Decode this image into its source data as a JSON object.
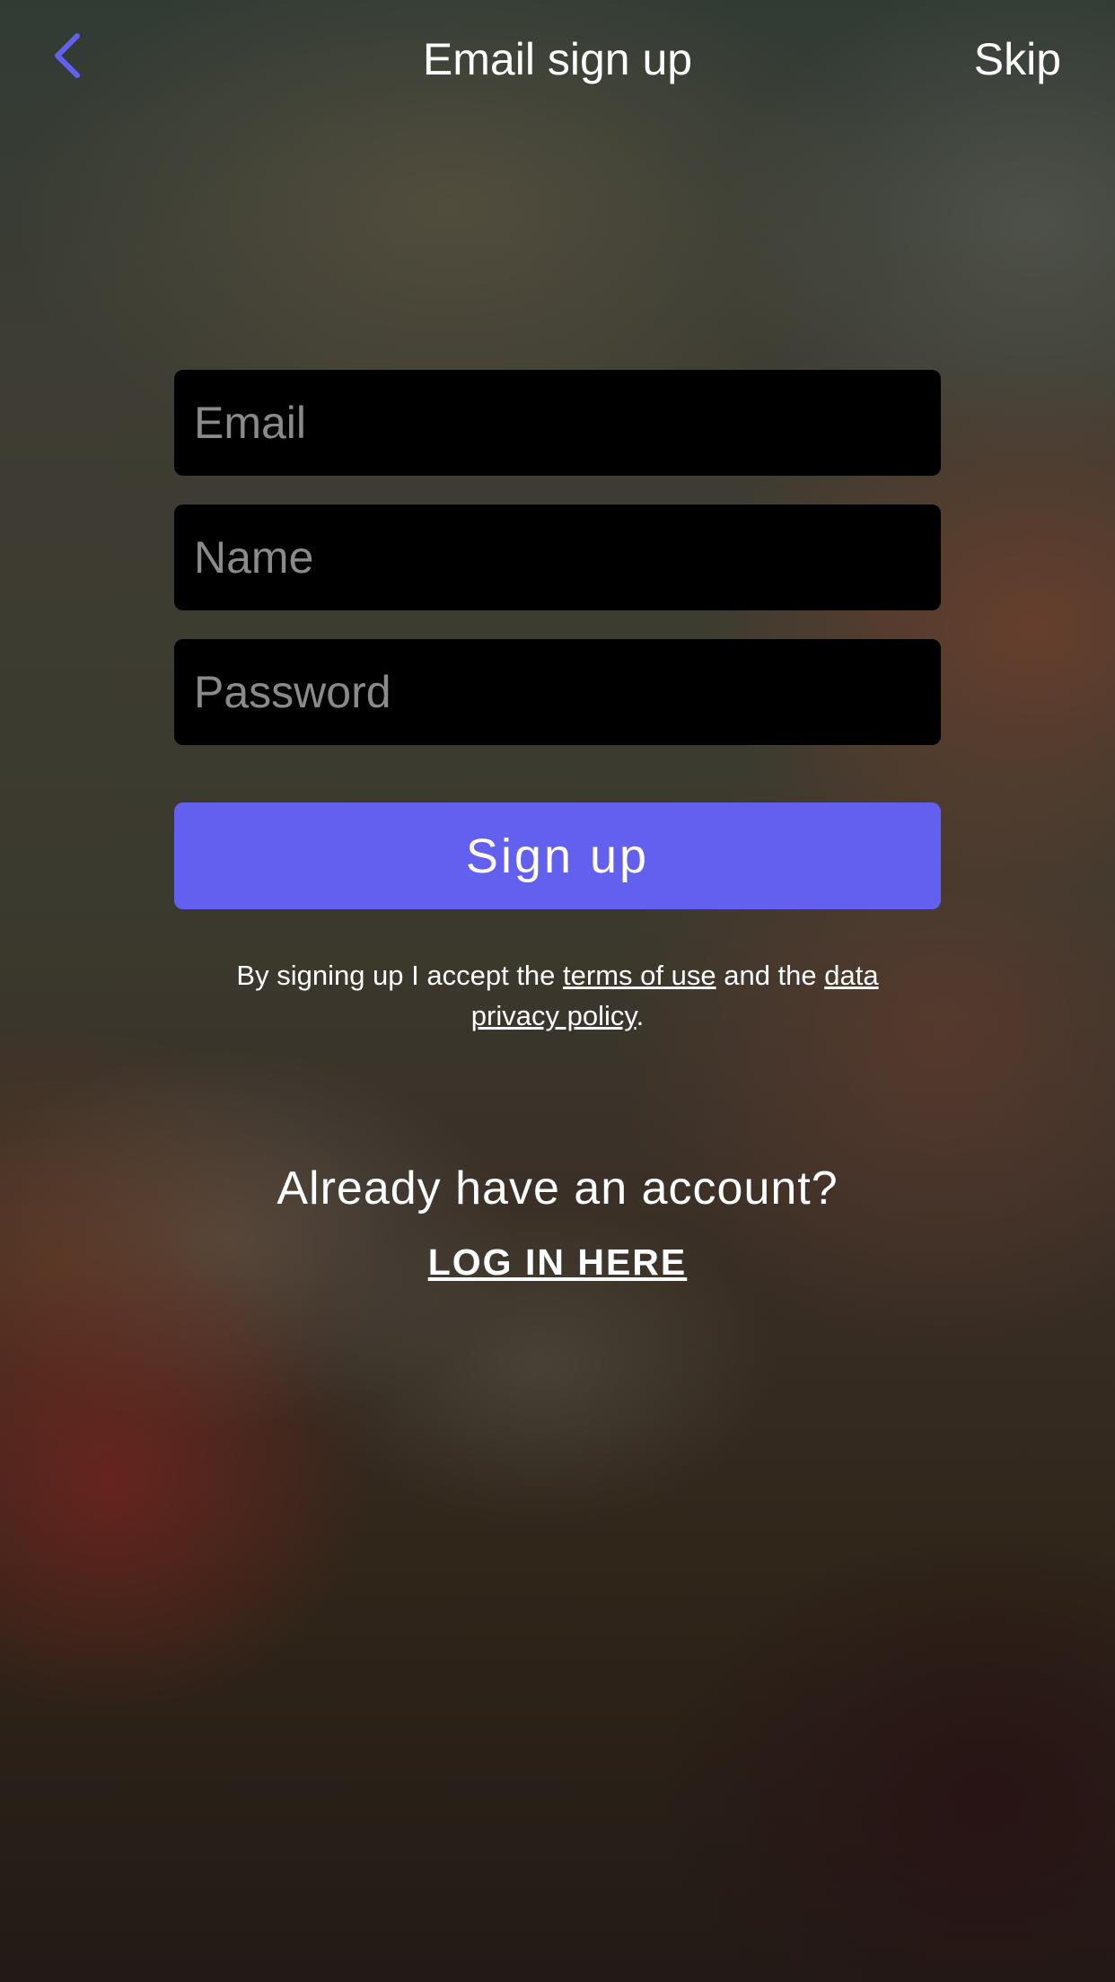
{
  "header": {
    "title": "Email sign up",
    "skip_label": "Skip"
  },
  "form": {
    "email_placeholder": "Email",
    "name_placeholder": "Name",
    "password_placeholder": "Password",
    "signup_label": "Sign up"
  },
  "terms": {
    "prefix": "By signing up I accept the ",
    "terms_link": "terms of use",
    "middle": " and the ",
    "policy_link": "data privacy policy",
    "suffix": "."
  },
  "login": {
    "prompt": "Already have an account?",
    "link_label": "LOG IN HERE"
  },
  "colors": {
    "accent": "#6360f0",
    "field_bg": "#000000",
    "placeholder": "#8a8a8a"
  },
  "icons": {
    "back": "chevron-left-icon"
  }
}
